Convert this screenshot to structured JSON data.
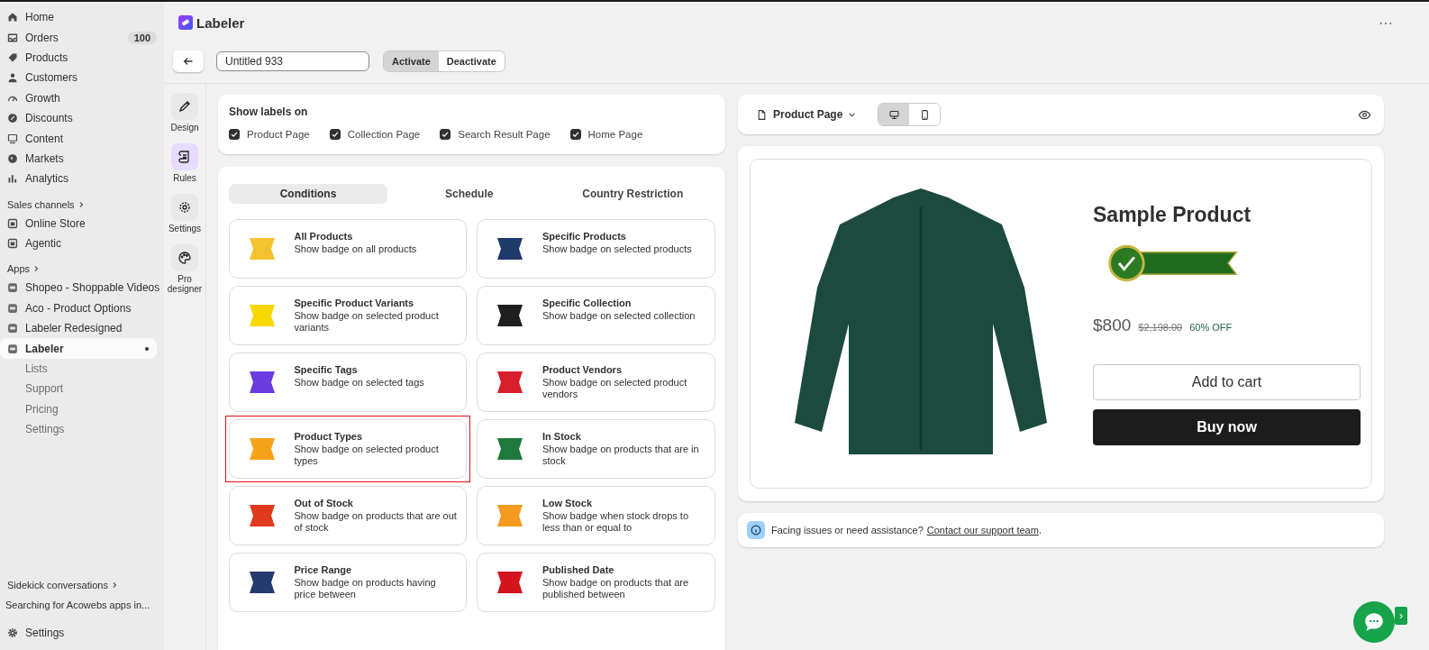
{
  "sidebar": {
    "items": [
      {
        "label": "Home"
      },
      {
        "label": "Orders",
        "count": "100"
      },
      {
        "label": "Products"
      },
      {
        "label": "Customers"
      },
      {
        "label": "Growth"
      },
      {
        "label": "Discounts"
      },
      {
        "label": "Content"
      },
      {
        "label": "Markets"
      },
      {
        "label": "Analytics"
      }
    ],
    "sales_channels": {
      "heading": "Sales channels",
      "items": [
        {
          "label": "Online Store"
        },
        {
          "label": "Agentic"
        }
      ]
    },
    "apps": {
      "heading": "Apps",
      "items": [
        {
          "label": "Shopeo - Shoppable Videos",
          "selected": false
        },
        {
          "label": "Aco - Product Options",
          "selected": false
        },
        {
          "label": "Labeler Redesigned",
          "selected": false
        },
        {
          "label": "Labeler",
          "selected": true,
          "children": [
            {
              "label": "Lists"
            },
            {
              "label": "Support"
            },
            {
              "label": "Pricing"
            },
            {
              "label": "Settings"
            }
          ]
        }
      ]
    },
    "sidekick": {
      "heading": "Sidekick conversations",
      "items": [
        "Searching for Acowebs apps in..."
      ]
    },
    "settings": "Settings"
  },
  "header": {
    "title": "Labeler",
    "more": "⋯"
  },
  "toolbar": {
    "name": "Untitled 933",
    "status": [
      {
        "label": "Activate",
        "selected": true
      },
      {
        "label": "Deactivate",
        "selected": false
      }
    ]
  },
  "rail": [
    {
      "label": "Design",
      "selected": false
    },
    {
      "label": "Rules",
      "selected": true
    },
    {
      "label": "Settings",
      "selected": false
    },
    {
      "label": "Pro designer",
      "selected": false
    }
  ],
  "show_labels": {
    "heading": "Show labels on",
    "options": [
      {
        "label": "Product Page",
        "checked": true
      },
      {
        "label": "Collection Page",
        "checked": true
      },
      {
        "label": "Search Result Page",
        "checked": true
      },
      {
        "label": "Home Page",
        "checked": true
      }
    ]
  },
  "tabs": [
    {
      "label": "Conditions",
      "selected": true
    },
    {
      "label": "Schedule",
      "selected": false
    },
    {
      "label": "Country Restriction",
      "selected": false
    }
  ],
  "conditions": [
    {
      "title": "All Products",
      "desc": "Show badge on all products",
      "selected": false
    },
    {
      "title": "Specific Products",
      "desc": "Show badge on selected products",
      "selected": false
    },
    {
      "title": "Specific Product Variants",
      "desc": "Show badge on selected product variants",
      "selected": false
    },
    {
      "title": "Specific Collection",
      "desc": "Show badge on selected collection",
      "selected": false
    },
    {
      "title": "Specific Tags",
      "desc": "Show badge on selected tags",
      "selected": false
    },
    {
      "title": "Product Vendors",
      "desc": "Show badge on selected product vendors",
      "selected": false
    },
    {
      "title": "Product Types",
      "desc": "Show badge on selected product types",
      "selected": true
    },
    {
      "title": "In Stock",
      "desc": "Show badge on products that are in stock",
      "selected": false
    },
    {
      "title": "Out of Stock",
      "desc": "Show badge on products that are out of stock",
      "selected": false
    },
    {
      "title": "Low Stock",
      "desc": "Show badge when stock drops to less than or equal to",
      "selected": false
    },
    {
      "title": "Price Range",
      "desc": "Show badge on products having price between",
      "selected": false
    },
    {
      "title": "Published Date",
      "desc": "Show badge on products that are published between",
      "selected": false
    }
  ],
  "preview": {
    "page": "Product Page",
    "views": [
      {
        "kind": "desktop",
        "selected": true
      },
      {
        "kind": "mobile",
        "selected": false
      }
    ],
    "product": {
      "title": "Sample Product",
      "price": "$800",
      "compare_price": "$2,198.00",
      "discount": "60% OFF",
      "add_to_cart": "Add to cart",
      "buy_now": "Buy now"
    }
  },
  "notice": {
    "text": "Facing issues or need assistance?",
    "link": "Contact our support team",
    "end": "."
  },
  "chat_tab": "›"
}
